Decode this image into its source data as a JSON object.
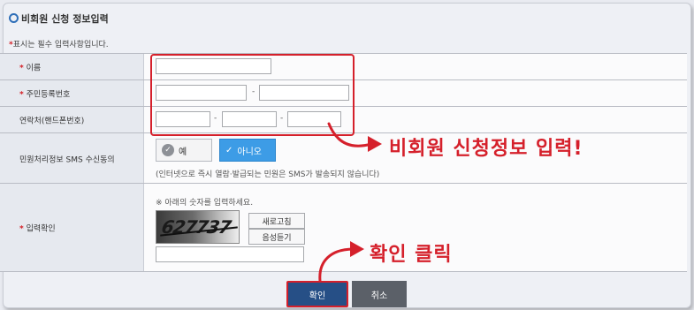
{
  "header": {
    "title": "비회원 신청 정보입력"
  },
  "notice": {
    "star": "*",
    "text": "표시는 필수 입력사항입니다."
  },
  "fields": {
    "name": {
      "star": "*",
      "label": "이름"
    },
    "rrn": {
      "star": "*",
      "label": "주민등록번호",
      "separator": "-"
    },
    "phone": {
      "label": "연락처(핸드폰번호)",
      "separator": "-"
    },
    "sms": {
      "label": "민원처리정보 SMS 수신동의",
      "options": [
        {
          "label": "예",
          "selected": false
        },
        {
          "label": "아니오",
          "selected": true
        }
      ],
      "hint": "(인터넷으로 즉시 열람·발급되는 민원은 SMS가 발송되지 않습니다)"
    },
    "captcha": {
      "star": "*",
      "label": "입력확인",
      "instruction": "※ 아래의 숫자를 입력하세요.",
      "image_text": "627737",
      "refresh_label": "새로고침",
      "audio_label": "음성듣기"
    }
  },
  "buttons": {
    "confirm": "확인",
    "cancel": "취소"
  },
  "annotations": {
    "input_hint": "비회원 신청정보 입력!",
    "click_hint": "확인 클릭"
  },
  "colors": {
    "accent": "#d5202b",
    "selected": "#3d9ce6",
    "confirm": "#264f86",
    "cancel": "#5b6068"
  }
}
